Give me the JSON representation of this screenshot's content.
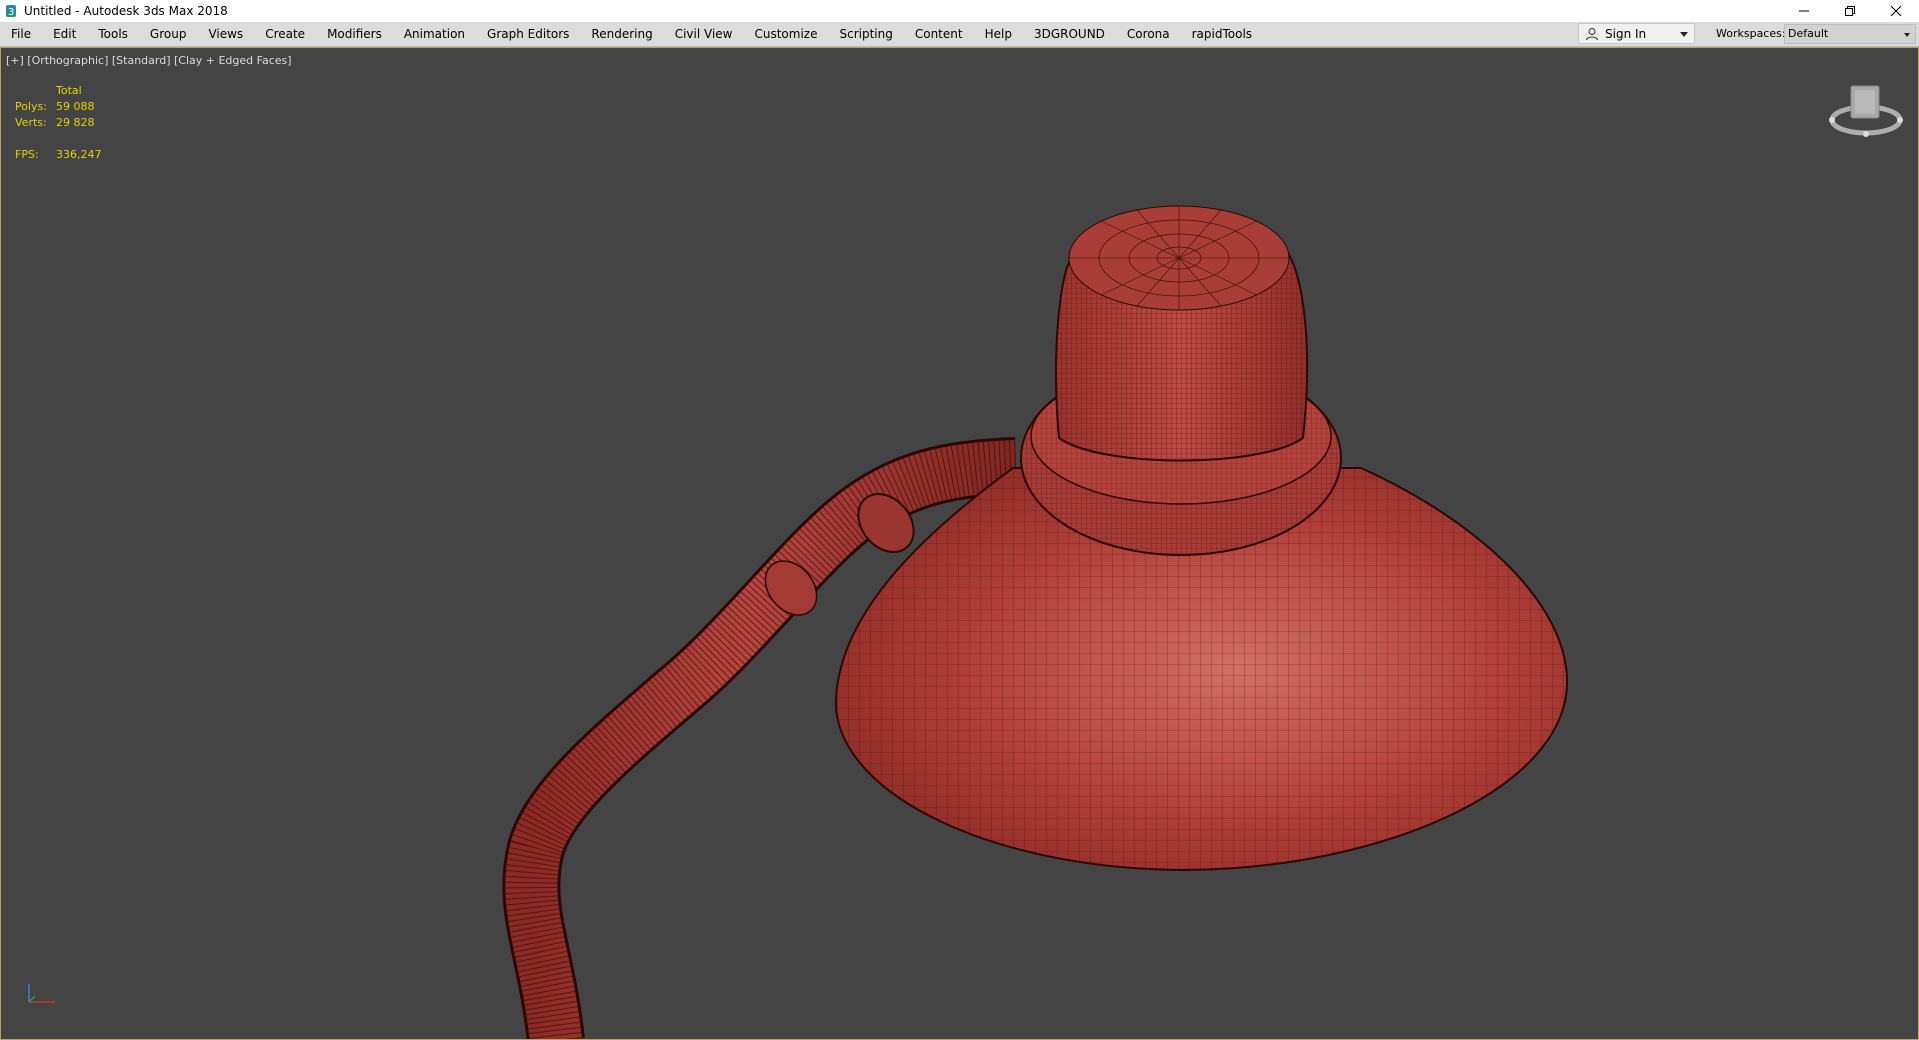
{
  "window": {
    "title": "Untitled - Autodesk 3ds Max 2018",
    "controls": [
      "minimize-icon",
      "restore-icon",
      "close-icon"
    ]
  },
  "menubar": {
    "items": [
      "File",
      "Edit",
      "Tools",
      "Group",
      "Views",
      "Create",
      "Modifiers",
      "Animation",
      "Graph Editors",
      "Rendering",
      "Civil View",
      "Customize",
      "Scripting",
      "Content",
      "Help",
      "3DGROUND",
      "Corona",
      "rapidTools"
    ],
    "signin": {
      "label": "Sign In",
      "icon": "user-icon"
    },
    "workspaces": {
      "label": "Workspaces:",
      "value": "Default"
    }
  },
  "viewport": {
    "label": "[+] [Orthographic] [Standard] [Clay + Edged Faces]",
    "stats": {
      "header": "Total",
      "polys_label": "Polys:",
      "polys": "59 088",
      "verts_label": "Verts:",
      "verts": "29 828",
      "fps_label": "FPS:",
      "fps": "336,247"
    },
    "model_color": "#b9413a",
    "wire_color": "#3a0d0a",
    "stats_color": "#e6d200"
  }
}
